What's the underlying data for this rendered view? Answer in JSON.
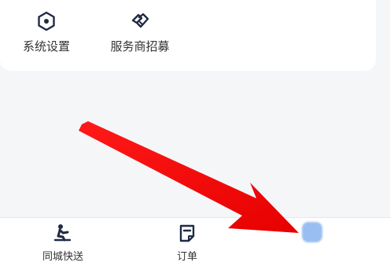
{
  "grid": {
    "items": [
      {
        "label": "系统设置",
        "icon": "hexagon-gear-icon"
      },
      {
        "label": "服务商招募",
        "icon": "handshake-icon"
      }
    ]
  },
  "tabbar": {
    "tabs": [
      {
        "label": "同城快送",
        "icon": "running-person-icon"
      },
      {
        "label": "订单",
        "icon": "order-note-icon"
      },
      {
        "label": "",
        "icon": "blurred-tab-icon"
      }
    ]
  },
  "colors": {
    "background": "#f5f6f8",
    "card": "#ffffff",
    "icon": "#1f2a44",
    "accent_blue": "#8fb8f0",
    "arrow": "#e8000b"
  }
}
